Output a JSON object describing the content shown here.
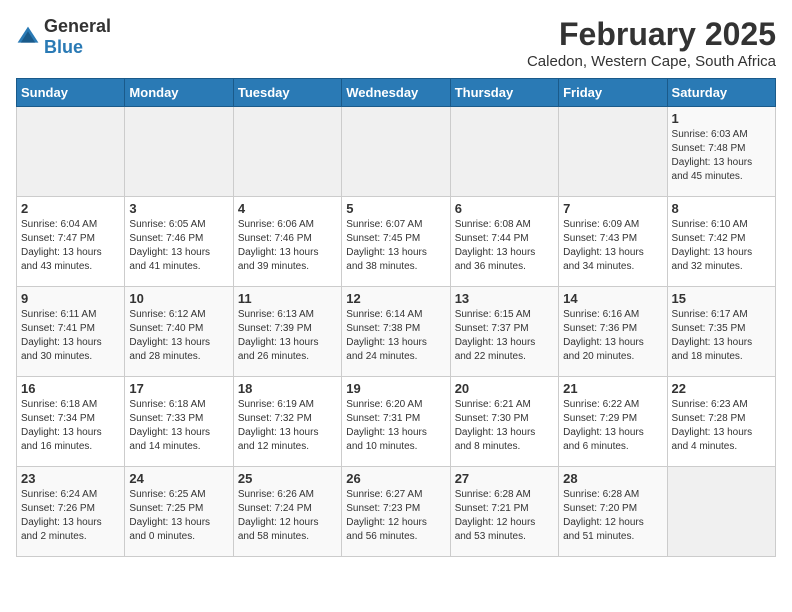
{
  "header": {
    "logo_general": "General",
    "logo_blue": "Blue",
    "month_title": "February 2025",
    "subtitle": "Caledon, Western Cape, South Africa"
  },
  "days_of_week": [
    "Sunday",
    "Monday",
    "Tuesday",
    "Wednesday",
    "Thursday",
    "Friday",
    "Saturday"
  ],
  "weeks": [
    [
      {
        "day": "",
        "info": ""
      },
      {
        "day": "",
        "info": ""
      },
      {
        "day": "",
        "info": ""
      },
      {
        "day": "",
        "info": ""
      },
      {
        "day": "",
        "info": ""
      },
      {
        "day": "",
        "info": ""
      },
      {
        "day": "1",
        "info": "Sunrise: 6:03 AM\nSunset: 7:48 PM\nDaylight: 13 hours\nand 45 minutes."
      }
    ],
    [
      {
        "day": "2",
        "info": "Sunrise: 6:04 AM\nSunset: 7:47 PM\nDaylight: 13 hours\nand 43 minutes."
      },
      {
        "day": "3",
        "info": "Sunrise: 6:05 AM\nSunset: 7:46 PM\nDaylight: 13 hours\nand 41 minutes."
      },
      {
        "day": "4",
        "info": "Sunrise: 6:06 AM\nSunset: 7:46 PM\nDaylight: 13 hours\nand 39 minutes."
      },
      {
        "day": "5",
        "info": "Sunrise: 6:07 AM\nSunset: 7:45 PM\nDaylight: 13 hours\nand 38 minutes."
      },
      {
        "day": "6",
        "info": "Sunrise: 6:08 AM\nSunset: 7:44 PM\nDaylight: 13 hours\nand 36 minutes."
      },
      {
        "day": "7",
        "info": "Sunrise: 6:09 AM\nSunset: 7:43 PM\nDaylight: 13 hours\nand 34 minutes."
      },
      {
        "day": "8",
        "info": "Sunrise: 6:10 AM\nSunset: 7:42 PM\nDaylight: 13 hours\nand 32 minutes."
      }
    ],
    [
      {
        "day": "9",
        "info": "Sunrise: 6:11 AM\nSunset: 7:41 PM\nDaylight: 13 hours\nand 30 minutes."
      },
      {
        "day": "10",
        "info": "Sunrise: 6:12 AM\nSunset: 7:40 PM\nDaylight: 13 hours\nand 28 minutes."
      },
      {
        "day": "11",
        "info": "Sunrise: 6:13 AM\nSunset: 7:39 PM\nDaylight: 13 hours\nand 26 minutes."
      },
      {
        "day": "12",
        "info": "Sunrise: 6:14 AM\nSunset: 7:38 PM\nDaylight: 13 hours\nand 24 minutes."
      },
      {
        "day": "13",
        "info": "Sunrise: 6:15 AM\nSunset: 7:37 PM\nDaylight: 13 hours\nand 22 minutes."
      },
      {
        "day": "14",
        "info": "Sunrise: 6:16 AM\nSunset: 7:36 PM\nDaylight: 13 hours\nand 20 minutes."
      },
      {
        "day": "15",
        "info": "Sunrise: 6:17 AM\nSunset: 7:35 PM\nDaylight: 13 hours\nand 18 minutes."
      }
    ],
    [
      {
        "day": "16",
        "info": "Sunrise: 6:18 AM\nSunset: 7:34 PM\nDaylight: 13 hours\nand 16 minutes."
      },
      {
        "day": "17",
        "info": "Sunrise: 6:18 AM\nSunset: 7:33 PM\nDaylight: 13 hours\nand 14 minutes."
      },
      {
        "day": "18",
        "info": "Sunrise: 6:19 AM\nSunset: 7:32 PM\nDaylight: 13 hours\nand 12 minutes."
      },
      {
        "day": "19",
        "info": "Sunrise: 6:20 AM\nSunset: 7:31 PM\nDaylight: 13 hours\nand 10 minutes."
      },
      {
        "day": "20",
        "info": "Sunrise: 6:21 AM\nSunset: 7:30 PM\nDaylight: 13 hours\nand 8 minutes."
      },
      {
        "day": "21",
        "info": "Sunrise: 6:22 AM\nSunset: 7:29 PM\nDaylight: 13 hours\nand 6 minutes."
      },
      {
        "day": "22",
        "info": "Sunrise: 6:23 AM\nSunset: 7:28 PM\nDaylight: 13 hours\nand 4 minutes."
      }
    ],
    [
      {
        "day": "23",
        "info": "Sunrise: 6:24 AM\nSunset: 7:26 PM\nDaylight: 13 hours\nand 2 minutes."
      },
      {
        "day": "24",
        "info": "Sunrise: 6:25 AM\nSunset: 7:25 PM\nDaylight: 13 hours\nand 0 minutes."
      },
      {
        "day": "25",
        "info": "Sunrise: 6:26 AM\nSunset: 7:24 PM\nDaylight: 12 hours\nand 58 minutes."
      },
      {
        "day": "26",
        "info": "Sunrise: 6:27 AM\nSunset: 7:23 PM\nDaylight: 12 hours\nand 56 minutes."
      },
      {
        "day": "27",
        "info": "Sunrise: 6:28 AM\nSunset: 7:21 PM\nDaylight: 12 hours\nand 53 minutes."
      },
      {
        "day": "28",
        "info": "Sunrise: 6:28 AM\nSunset: 7:20 PM\nDaylight: 12 hours\nand 51 minutes."
      },
      {
        "day": "",
        "info": ""
      }
    ]
  ]
}
